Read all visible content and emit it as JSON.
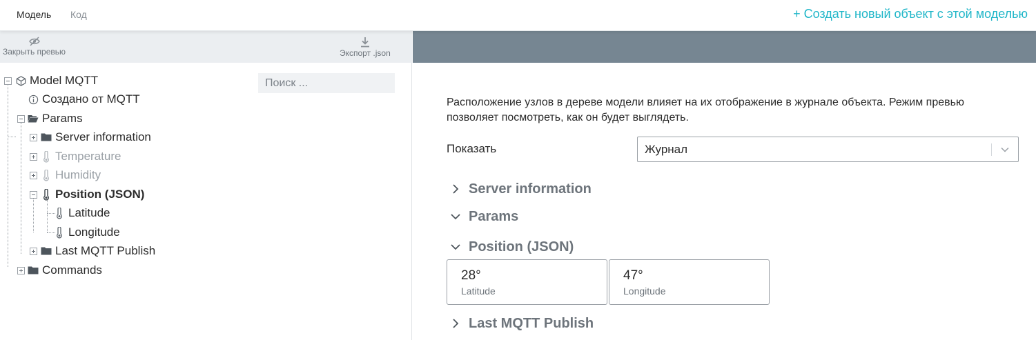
{
  "tabs": {
    "model": "Модель",
    "code": "Код"
  },
  "create_link": "+ Создать новый объект с этой моделью",
  "toolbar": {
    "close_preview": "Закрыть превью",
    "export": "Экспорт .json"
  },
  "search": {
    "placeholder": "Поиск ..."
  },
  "tree": {
    "root": "Model MQTT",
    "created": "Создано от MQTT",
    "params": "Params",
    "server_info": "Server information",
    "temperature": "Temperature",
    "humidity": "Humidity",
    "position": "Position (JSON)",
    "latitude": "Latitude",
    "longitude": "Longitude",
    "last_publish": "Last MQTT Publish",
    "commands": "Commands"
  },
  "preview": {
    "description": "Расположение узлов в дереве модели влияет на их отображение в журнале объекта. Режим превью позволяет посмотреть, как он будет выглядеть.",
    "show_label": "Показать",
    "show_value": "Журнал",
    "sections": {
      "server_info": "Server information",
      "params": "Params",
      "position": "Position (JSON)",
      "last_publish": "Last MQTT Publish"
    },
    "cards": {
      "latitude": {
        "value": "28°",
        "label": "Latitude"
      },
      "longitude": {
        "value": "47°",
        "label": "Longitude"
      }
    }
  },
  "colors": {
    "accent": "#1fb6c8",
    "header_bar": "#768692",
    "toolbar_bg": "#ebeef1"
  }
}
